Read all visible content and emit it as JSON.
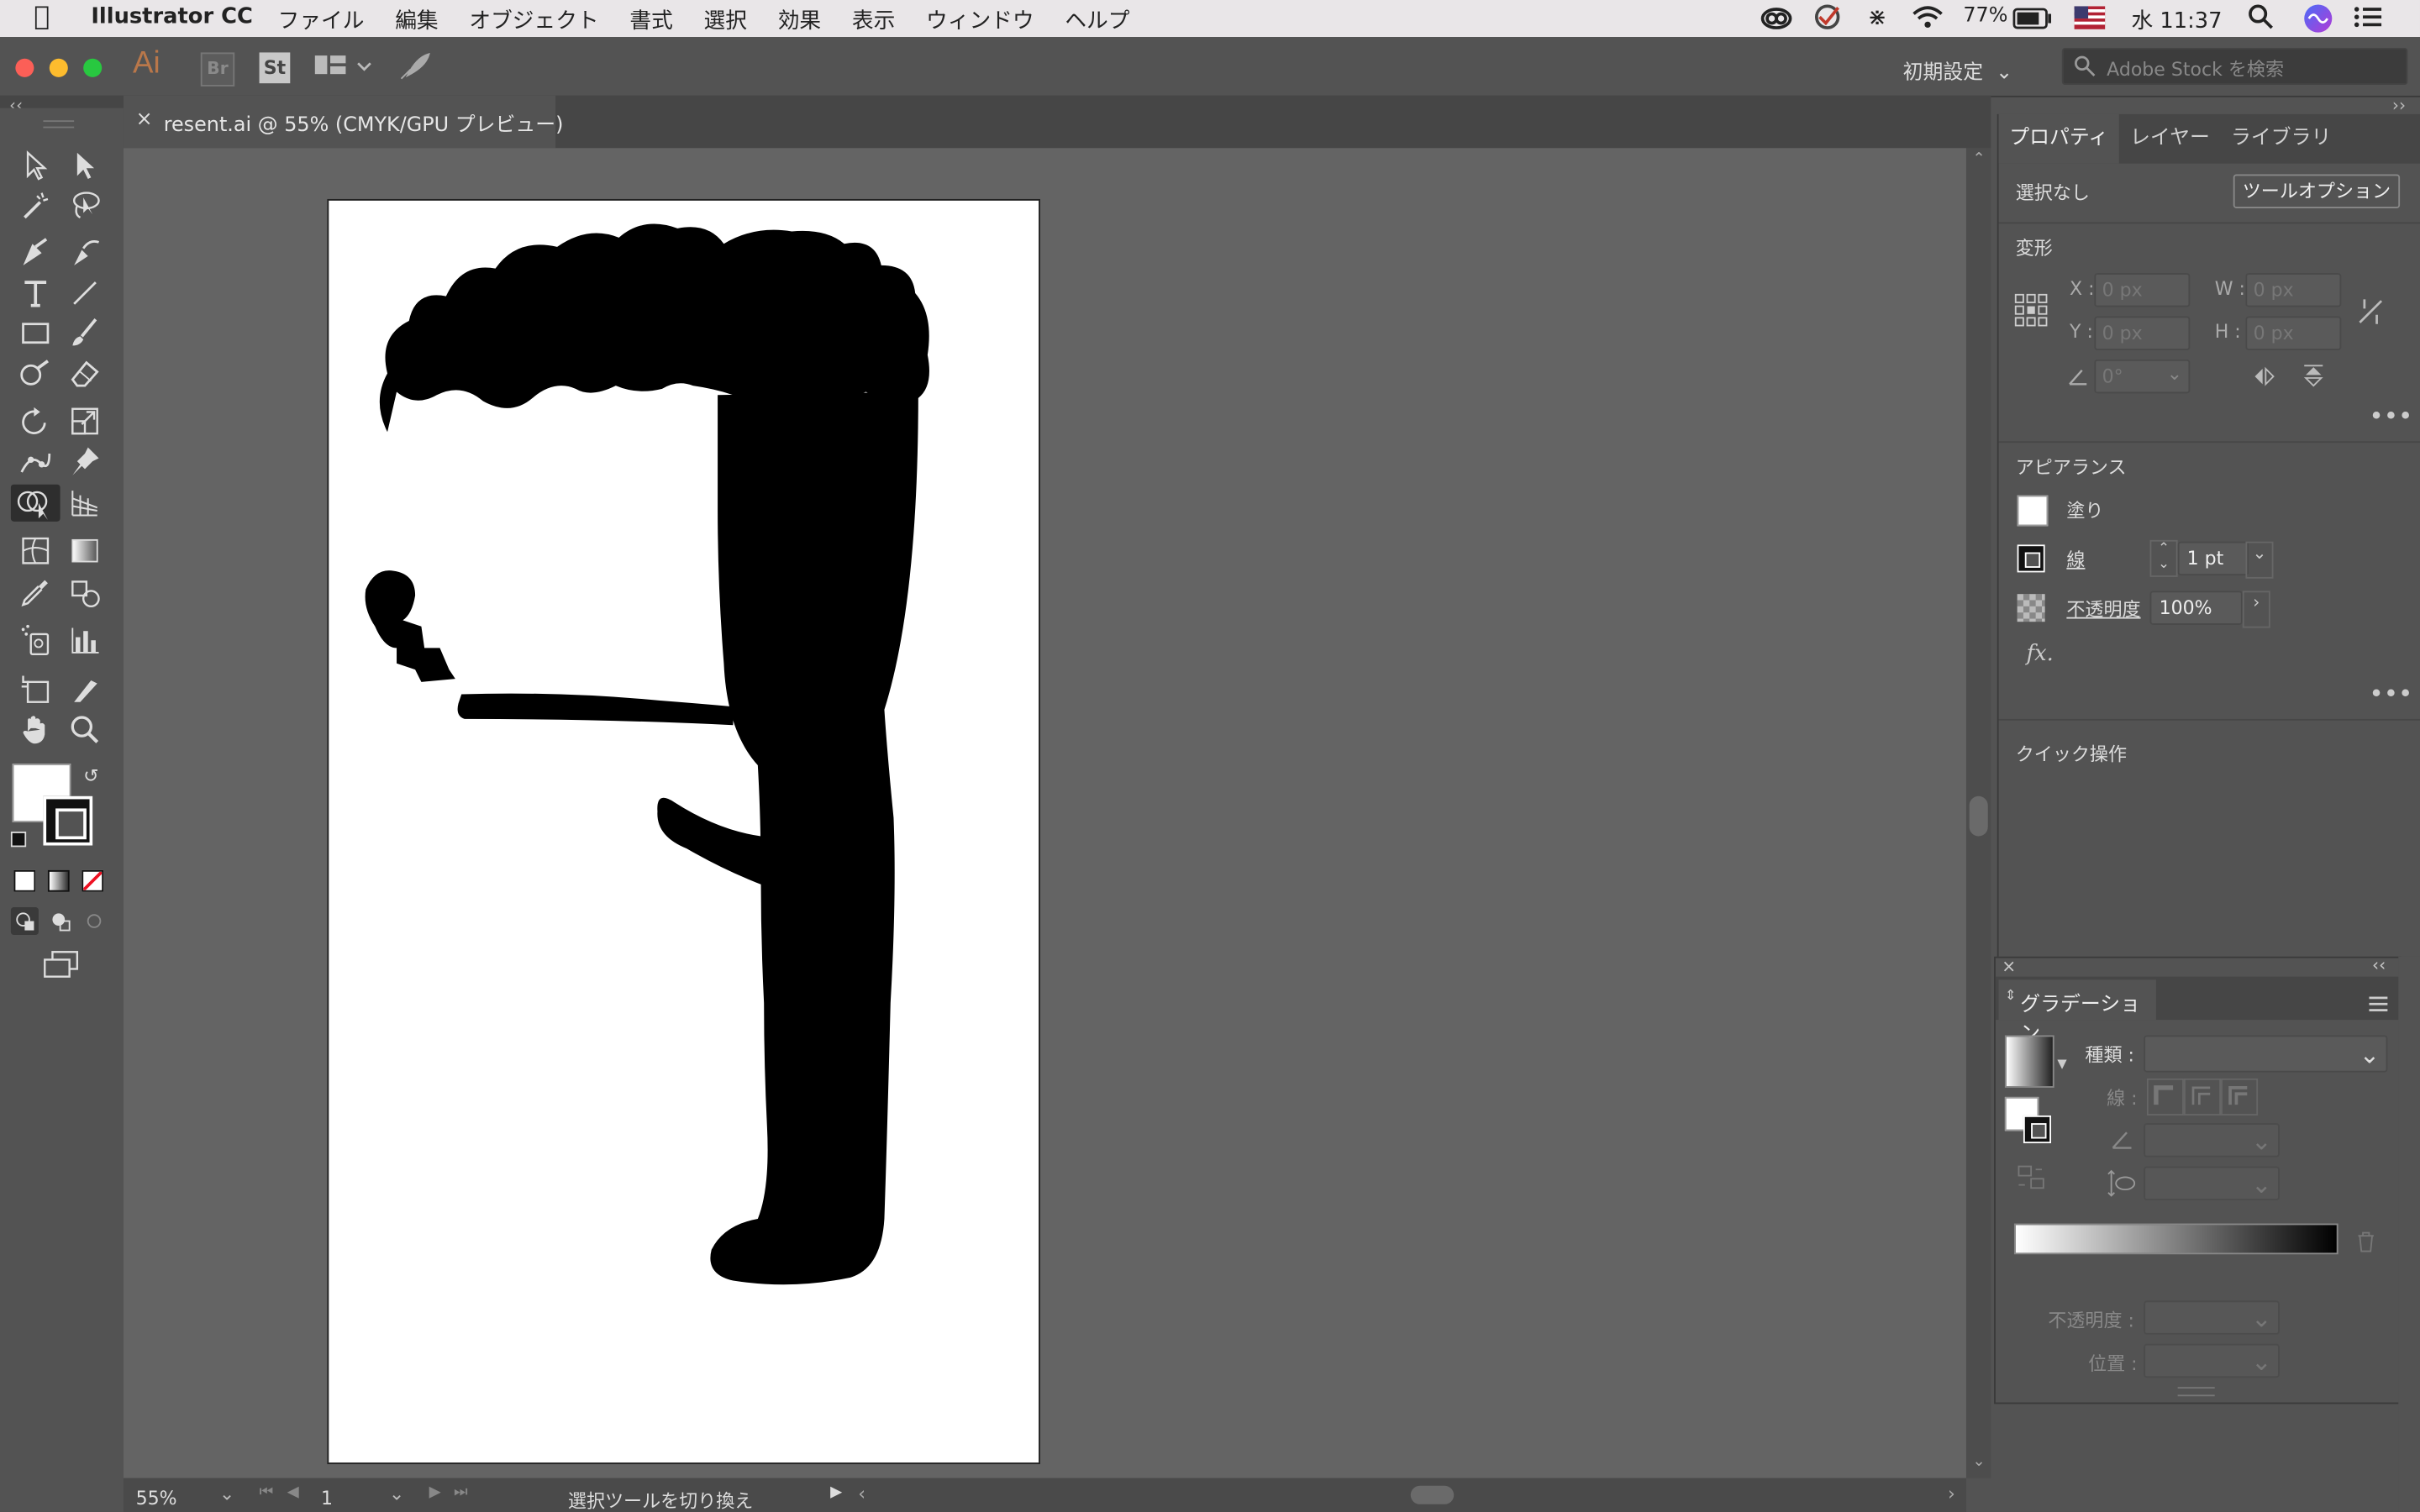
{
  "menubar": {
    "app_name": "Illustrator CC",
    "items": [
      "ファイル",
      "編集",
      "オブジェクト",
      "書式",
      "選択",
      "効果",
      "表示",
      "ウィンドウ",
      "ヘルプ"
    ],
    "battery": "77%",
    "clock": "水 11:37"
  },
  "appbar": {
    "logo": "Ai",
    "bridge": "Br",
    "stock_icon": "St",
    "workspace": "初期設定",
    "search_placeholder": "Adobe Stock を検索"
  },
  "document": {
    "tab_title": "resent.ai @ 55% (CMYK/GPU プレビュー)",
    "close": "×"
  },
  "status": {
    "zoom": "55%",
    "artboard": "1",
    "message": "選択ツールを切り換え"
  },
  "properties": {
    "tabs": [
      "プロパティ",
      "レイヤー",
      "ライブラリ"
    ],
    "selection": "選択なし",
    "tool_options_button": "ツールオプション",
    "transform": {
      "title": "変形",
      "x_label": "X :",
      "x_value": "0 px",
      "y_label": "Y :",
      "y_value": "0 px",
      "w_label": "W :",
      "w_value": "0 px",
      "h_label": "H :",
      "h_value": "0 px",
      "angle_value": "0°"
    },
    "appearance": {
      "title": "アピアランス",
      "fill_label": "塗り",
      "stroke_label": "線",
      "stroke_value": "1 pt",
      "opacity_label": "不透明度",
      "opacity_value": "100%",
      "fx": "fx."
    },
    "quick_actions": "クイック操作"
  },
  "gradient_panel": {
    "title": "グラデーション",
    "type_label": "種類 :",
    "stroke_label": "線 :",
    "opacity_label": "不透明度 :",
    "location_label": "位置 :"
  },
  "colors": {
    "ui_bg": "#535353",
    "canvas_bg": "#646464",
    "artboard": "#ffffff",
    "artwork": "#000000",
    "menubar_bg": "#e9e6e8",
    "close_light": "#fc5f57",
    "min_light": "#fdbc2e",
    "max_light": "#28c840"
  }
}
